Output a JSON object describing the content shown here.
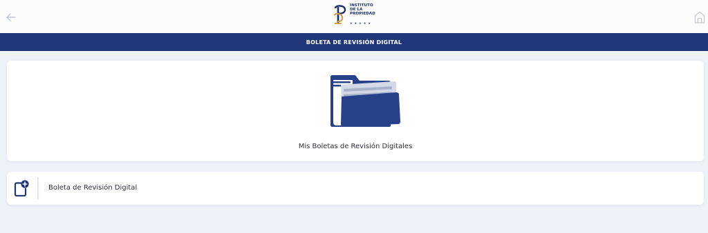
{
  "header": {
    "back_icon": "arrow-left-icon",
    "home_icon": "home-icon",
    "logo_text": "INSTITUTO\nDE LA\nPROPIEDAD",
    "logo_stars": "★★★★★"
  },
  "titlebar": {
    "title": "BOLETA DE REVISIÓN DIGITAL"
  },
  "main_card": {
    "icon": "folder-icon",
    "label": "Mis Boletas de Revisión Digitales"
  },
  "row_card": {
    "icon": "add-document-icon",
    "label": "Boleta de Revisión Digital"
  },
  "colors": {
    "brand": "#1f3679",
    "brand_gold": "#c9a24a",
    "background": "#eef1f8"
  }
}
